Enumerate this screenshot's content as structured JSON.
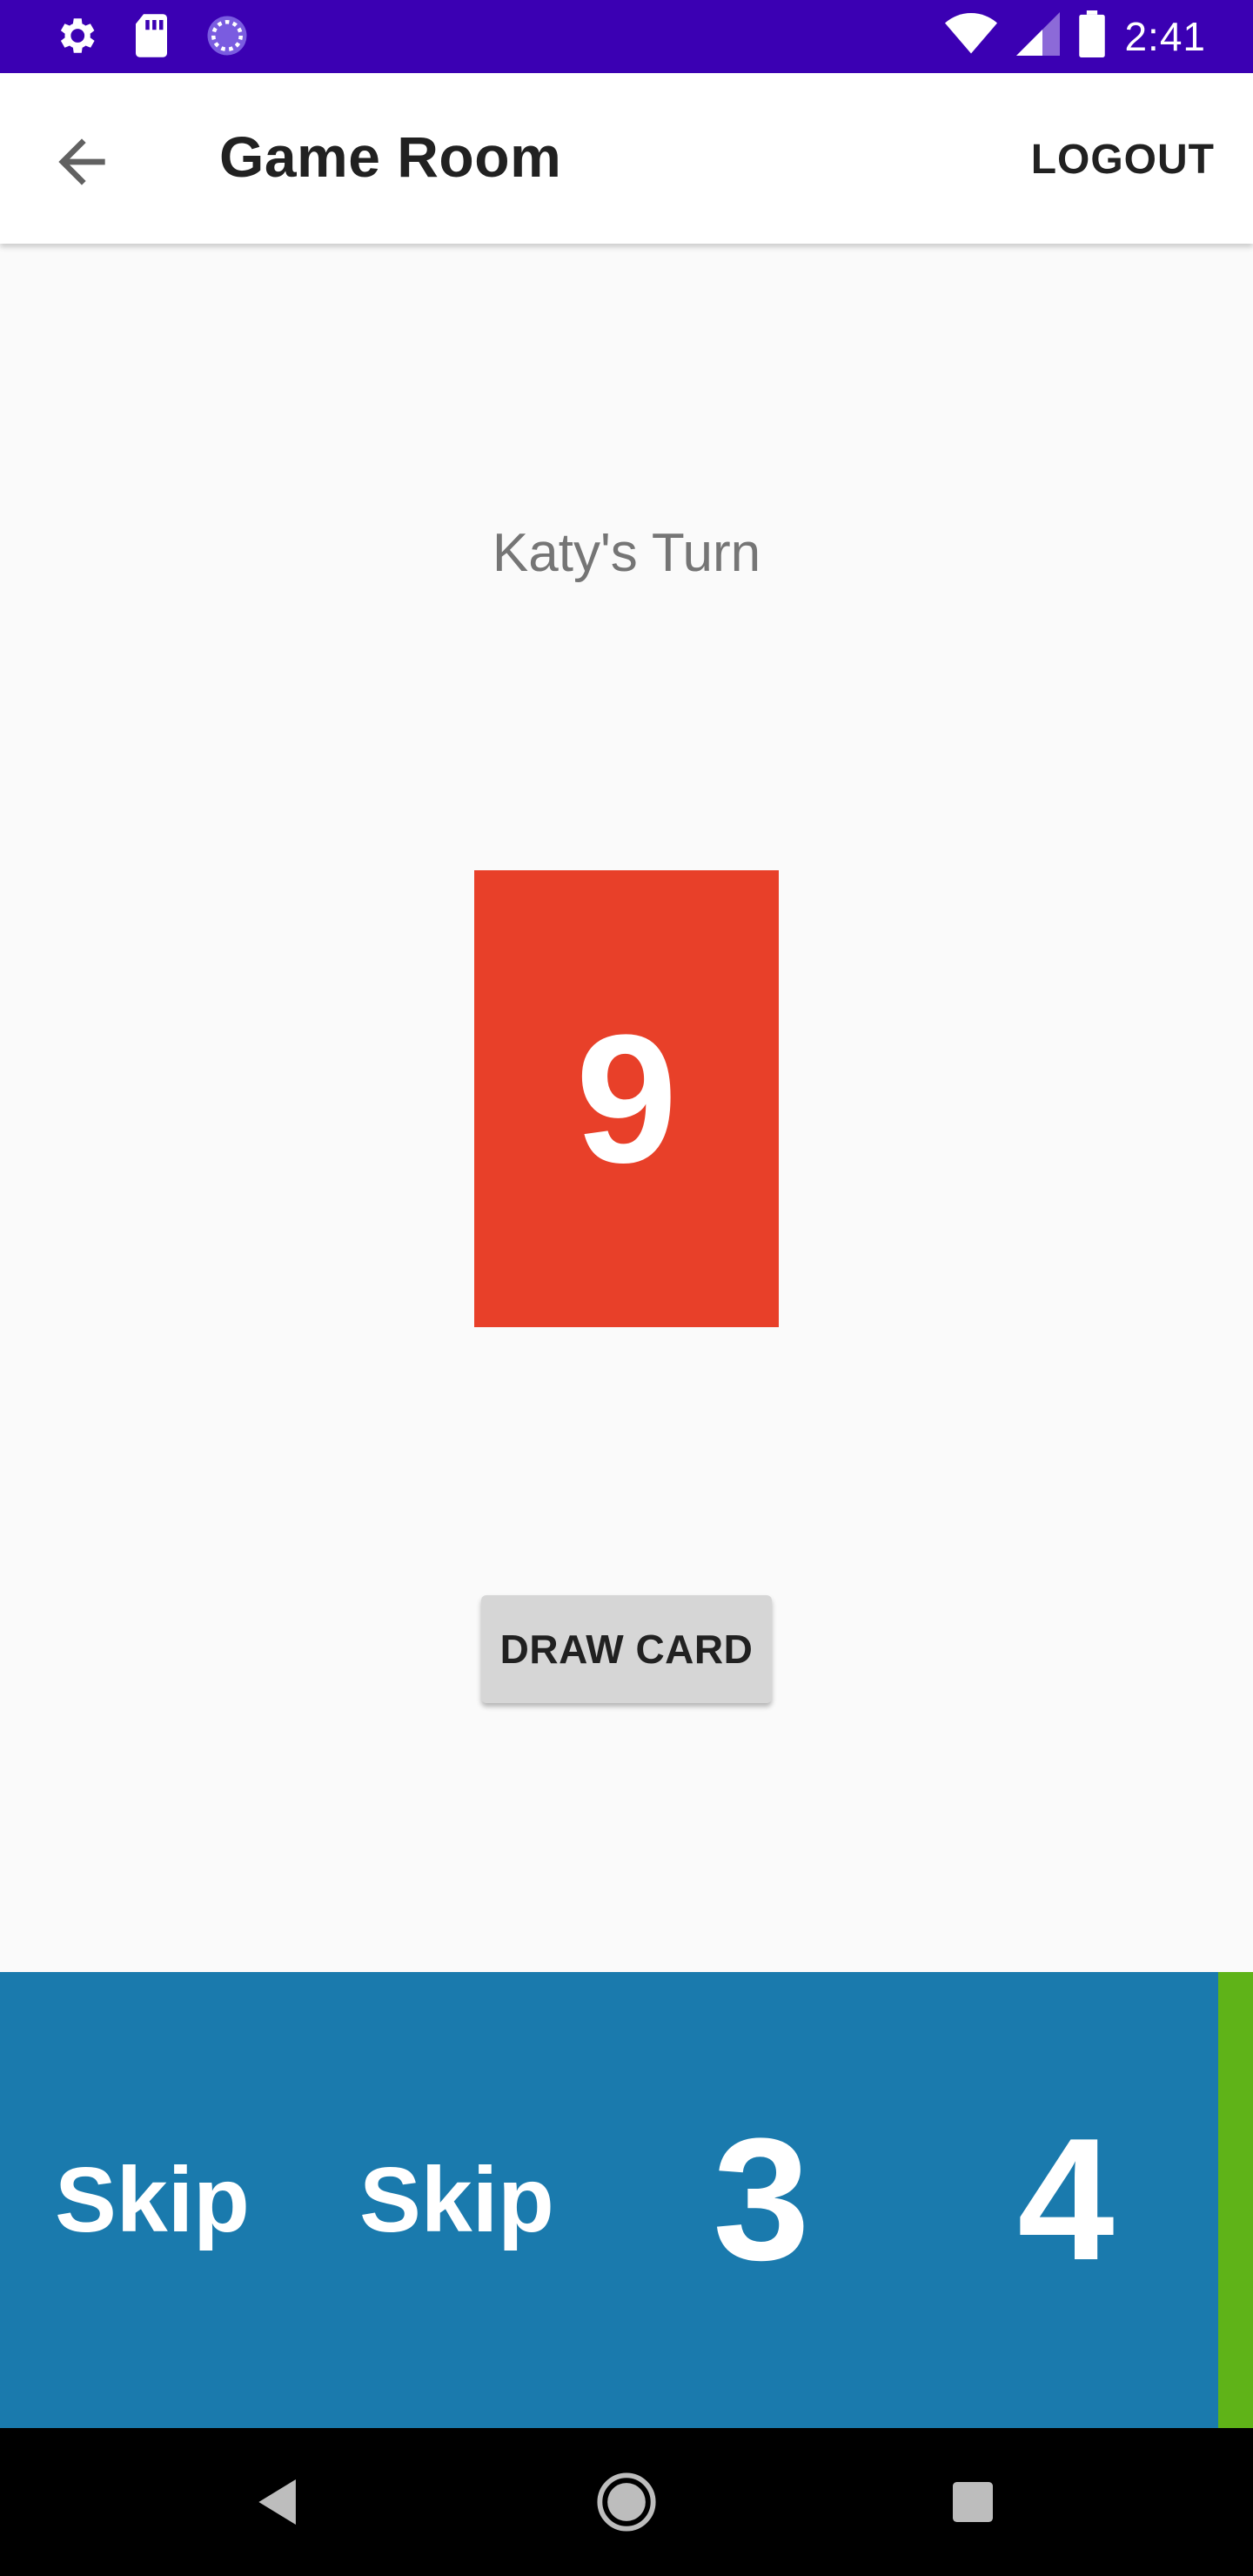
{
  "status_bar": {
    "time": "2:41",
    "left_icons": [
      "gear-icon",
      "sd-card-icon",
      "loading-icon"
    ],
    "right_icons": [
      "wifi-icon",
      "signal-icon",
      "battery-icon"
    ],
    "color": "#3b00b3"
  },
  "app_bar": {
    "title": "Game Room",
    "logout_label": "LOGOUT",
    "back_icon": "arrow-back-icon"
  },
  "main": {
    "turn_text": "Katy's Turn",
    "card": {
      "value": "9",
      "color": "#e84029"
    },
    "draw_button_label": "DRAW CARD"
  },
  "hand": {
    "background": "#1a7aad",
    "edge_color": "#5fb318",
    "cards": [
      {
        "label": "Skip"
      },
      {
        "label": "Skip"
      },
      {
        "label": "3"
      },
      {
        "label": "4"
      }
    ]
  },
  "nav_bar": {
    "icons": [
      "nav-back-icon",
      "nav-home-icon",
      "nav-recents-icon"
    ]
  }
}
